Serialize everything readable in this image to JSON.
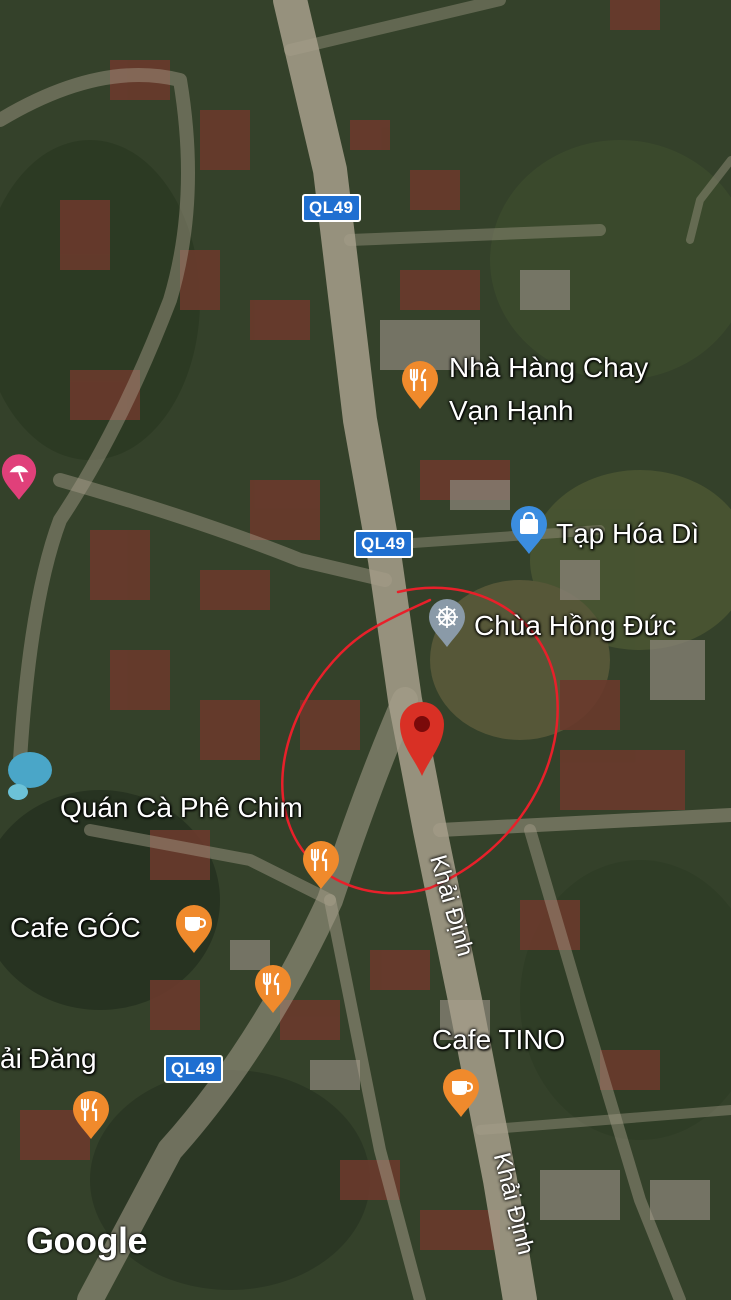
{
  "map": {
    "route_shields": [
      "QL49",
      "QL49",
      "QL49"
    ],
    "poi_labels": {
      "restaurant_chay_line1": "Nhà Hàng Chay",
      "restaurant_chay_line2": "Vạn Hạnh",
      "grocery": "Tạp Hóa Dì",
      "pagoda": "Chùa Hồng Đức",
      "cafe_chim": "Quán Cà Phê Chim",
      "cafe_goc": "Cafe GÓC",
      "restaurant_left": "ải Đăng",
      "cafe_tino": "Cafe TINO"
    },
    "street_labels": [
      "Khải Định",
      "Khải Định"
    ],
    "icons": {
      "restaurant": "fork-knife-icon",
      "shopping": "shopping-bag-icon",
      "pagoda": "dharma-wheel-icon",
      "cafe": "coffee-cup-icon",
      "beach": "umbrella-icon",
      "pin": "location-pin-icon"
    },
    "colors": {
      "poi_orange": "#f08a2c",
      "poi_blue": "#3b8de0",
      "poi_grey": "#8a9aa8",
      "poi_pink": "#e0407a",
      "pin_red": "#d93025",
      "annotation_red": "#e8202a",
      "shield_blue": "#1f6fd1"
    },
    "attribution": "Google"
  }
}
